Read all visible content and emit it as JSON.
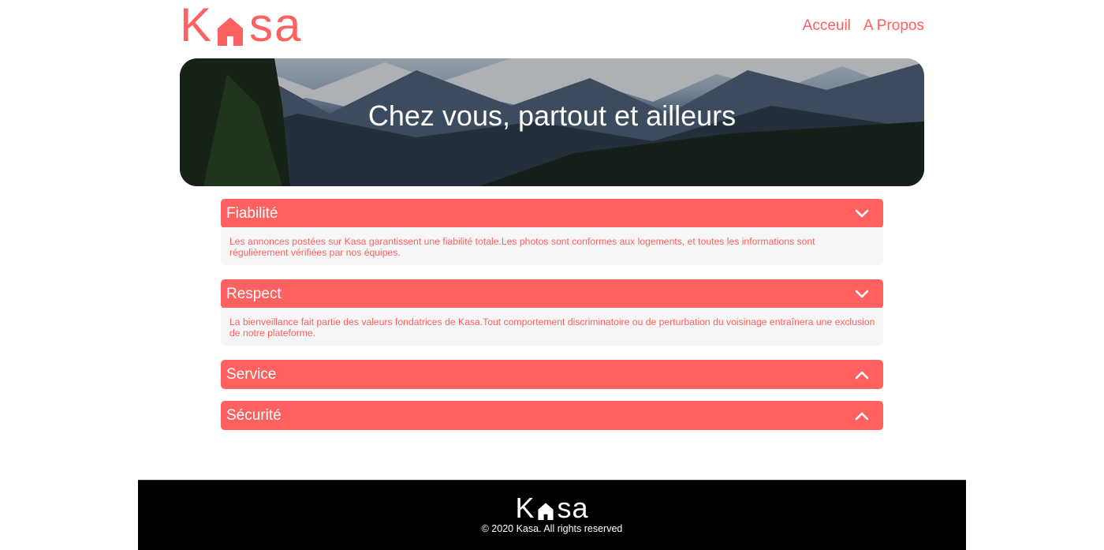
{
  "header": {
    "logo_text_left": "K",
    "logo_text_right": "sa",
    "nav": [
      {
        "label": "Acceuil"
      },
      {
        "label": "A Propos"
      }
    ]
  },
  "banner": {
    "title": "Chez vous, partout et ailleurs"
  },
  "accordion": [
    {
      "title": "Fiabilité",
      "state": "expanded",
      "content": "Les annonces postées sur Kasa garantissent une fiabilité totale.Les photos sont conformes aux logements, et toutes les informations sont régulièrement vérifiées par nos équipes."
    },
    {
      "title": "Respect",
      "state": "expanded",
      "content": "La bienveillance fait partie des valeurs fondatrices de Kasa.Tout comportement discriminatoire ou de perturbation du voisinage entraînera une exclusion de notre plateforme."
    },
    {
      "title": "Service",
      "state": "collapsed"
    },
    {
      "title": "Sécurité",
      "state": "collapsed"
    }
  ],
  "footer": {
    "logo_text_left": "K",
    "logo_text_right": "sa",
    "copyright": "© 2020 Kasa. All rights reserved"
  },
  "colors": {
    "brand": "#FF6060",
    "panel_bg": "#F6F6F6",
    "footer_bg": "#000000"
  }
}
